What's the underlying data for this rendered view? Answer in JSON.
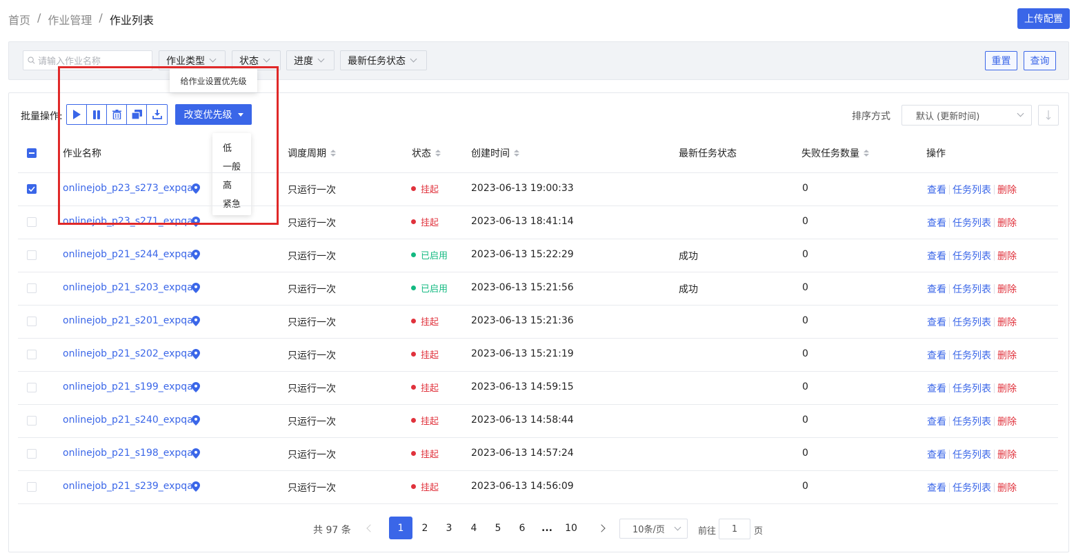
{
  "breadcrumb": {
    "home": "首页",
    "sep": "/",
    "mid": "作业管理",
    "current": "作业列表"
  },
  "upload_label": "上传配置",
  "filters": {
    "search_placeholder": "请输入作业名称",
    "type": "作业类型",
    "status": "状态",
    "progress": "进度",
    "latest_task_status": "最新任务状态",
    "reset": "重置",
    "query": "查询"
  },
  "toolbar": {
    "batch_label": "批量操作:",
    "priority_button": "改变优先级",
    "tooltip": "给作业设置优先级",
    "priority_options": [
      "低",
      "一般",
      "高",
      "紧急"
    ],
    "sort_label": "排序方式",
    "sort_value": "默认 (更新时间)"
  },
  "colors": {
    "accent": "#3a66e8",
    "danger": "#e0323c",
    "success": "#13b981",
    "highlight_box": "#e02828"
  },
  "icons": [
    "play-icon",
    "pause-icon",
    "trash-icon",
    "copy-icon",
    "download-icon",
    "location-pin-icon",
    "sort-arrows-icon"
  ],
  "table": {
    "headers": {
      "name": "作业名称",
      "cycle": "调度周期",
      "status": "状态",
      "created": "创建时间",
      "latest": "最新任务状态",
      "failed": "失败任务数量",
      "ops": "操作"
    },
    "op_view": "查看",
    "op_tasks": "任务列表",
    "op_delete": "删除",
    "rows": [
      {
        "name": "onlinejob_p23_s273_expqa",
        "cycle": "只运行一次",
        "status": "挂起",
        "status_kind": "suspended",
        "created": "2023-06-13 19:00:33",
        "latest": "",
        "failed": "0",
        "checked": true
      },
      {
        "name": "onlinejob_p23_s271_expqa",
        "cycle": "只运行一次",
        "status": "挂起",
        "status_kind": "suspended",
        "created": "2023-06-13 18:41:14",
        "latest": "",
        "failed": "0",
        "checked": false
      },
      {
        "name": "onlinejob_p21_s244_expqa",
        "cycle": "只运行一次",
        "status": "已启用",
        "status_kind": "enabled",
        "created": "2023-06-13 15:22:29",
        "latest": "成功",
        "failed": "0",
        "checked": false
      },
      {
        "name": "onlinejob_p21_s203_expqa",
        "cycle": "只运行一次",
        "status": "已启用",
        "status_kind": "enabled",
        "created": "2023-06-13 15:21:56",
        "latest": "成功",
        "failed": "0",
        "checked": false
      },
      {
        "name": "onlinejob_p21_s201_expqa",
        "cycle": "只运行一次",
        "status": "挂起",
        "status_kind": "suspended",
        "created": "2023-06-13 15:21:36",
        "latest": "",
        "failed": "0",
        "checked": false
      },
      {
        "name": "onlinejob_p21_s202_expqa",
        "cycle": "只运行一次",
        "status": "挂起",
        "status_kind": "suspended",
        "created": "2023-06-13 15:21:19",
        "latest": "",
        "failed": "0",
        "checked": false
      },
      {
        "name": "onlinejob_p21_s199_expqa",
        "cycle": "只运行一次",
        "status": "挂起",
        "status_kind": "suspended",
        "created": "2023-06-13 14:59:15",
        "latest": "",
        "failed": "0",
        "checked": false
      },
      {
        "name": "onlinejob_p21_s240_expqa",
        "cycle": "只运行一次",
        "status": "挂起",
        "status_kind": "suspended",
        "created": "2023-06-13 14:58:44",
        "latest": "",
        "failed": "0",
        "checked": false
      },
      {
        "name": "onlinejob_p21_s198_expqa",
        "cycle": "只运行一次",
        "status": "挂起",
        "status_kind": "suspended",
        "created": "2023-06-13 14:57:24",
        "latest": "",
        "failed": "0",
        "checked": false
      },
      {
        "name": "onlinejob_p21_s239_expqa",
        "cycle": "只运行一次",
        "status": "挂起",
        "status_kind": "suspended",
        "created": "2023-06-13 14:56:09",
        "latest": "",
        "failed": "0",
        "checked": false
      }
    ]
  },
  "pagination": {
    "total": "共 97 条",
    "pages": [
      "1",
      "2",
      "3",
      "4",
      "5",
      "6"
    ],
    "ellipsis": "...",
    "last": "10",
    "current": "1",
    "page_size": "10条/页",
    "goto_prefix": "前往",
    "goto_value": "1",
    "goto_suffix": "页"
  }
}
